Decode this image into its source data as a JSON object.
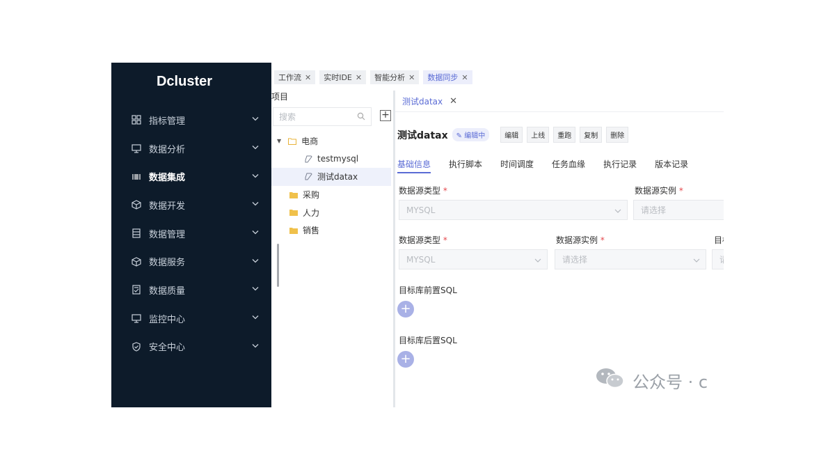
{
  "sidebar": {
    "brand": "Dcluster",
    "items": [
      {
        "label": "指标管理",
        "icon": "grid-icon",
        "active": false
      },
      {
        "label": "数据分析",
        "icon": "monitor-icon",
        "active": false
      },
      {
        "label": "数据集成",
        "icon": "barcode-icon",
        "active": true
      },
      {
        "label": "数据开发",
        "icon": "cube-icon",
        "active": false
      },
      {
        "label": "数据管理",
        "icon": "table-icon",
        "active": false
      },
      {
        "label": "数据服务",
        "icon": "box-icon",
        "active": false
      },
      {
        "label": "数据质量",
        "icon": "doc-check-icon",
        "active": false
      },
      {
        "label": "监控中心",
        "icon": "monitor-icon",
        "active": false
      },
      {
        "label": "安全中心",
        "icon": "shield-icon",
        "active": false
      }
    ]
  },
  "top_tabs": [
    {
      "label": "工作流",
      "active": false
    },
    {
      "label": "实时IDE",
      "active": false
    },
    {
      "label": "智能分析",
      "active": false
    },
    {
      "label": "数据同步",
      "active": true
    }
  ],
  "project": {
    "title": "项目",
    "search_placeholder": "搜索",
    "add_label": "+",
    "tree": [
      {
        "label": "电商",
        "type": "folder-open",
        "level": 0,
        "expanded": true
      },
      {
        "label": "testmysql",
        "type": "file",
        "level": 1
      },
      {
        "label": "测试datax",
        "type": "file",
        "level": 1,
        "selected": true
      },
      {
        "label": "采购",
        "type": "folder",
        "level": 0
      },
      {
        "label": "人力",
        "type": "folder",
        "level": 0
      },
      {
        "label": "销售",
        "type": "folder",
        "level": 0
      }
    ]
  },
  "editor": {
    "tab_label": "测试datax",
    "task_title": "测试datax",
    "status_badge": "编辑中",
    "actions": [
      "编辑",
      "上线",
      "重跑",
      "复制",
      "删除"
    ],
    "subtabs": [
      "基础信息",
      "执行脚本",
      "时间调度",
      "任务血缘",
      "执行记录",
      "版本记录"
    ],
    "form": {
      "row1": {
        "source_type_label": "数据源类型",
        "source_type_value": "MYSQL",
        "source_instance_label": "数据源实例",
        "source_instance_placeholder": "请选择"
      },
      "row2": {
        "source_type_label": "数据源类型",
        "source_type_value": "MYSQL",
        "source_instance_label": "数据源实例",
        "source_instance_placeholder": "请选择",
        "target_label_partial": "目标",
        "target_value_partial": "请"
      },
      "required_mark": "*",
      "pre_sql_label": "目标库前置SQL",
      "post_sql_label": "目标库后置SQL"
    }
  },
  "watermark": "公众号 · c",
  "colors": {
    "sidebar_bg": "#0d1b2a",
    "accent": "#5a6bd5",
    "plus_bg": "#a9b1e6"
  }
}
